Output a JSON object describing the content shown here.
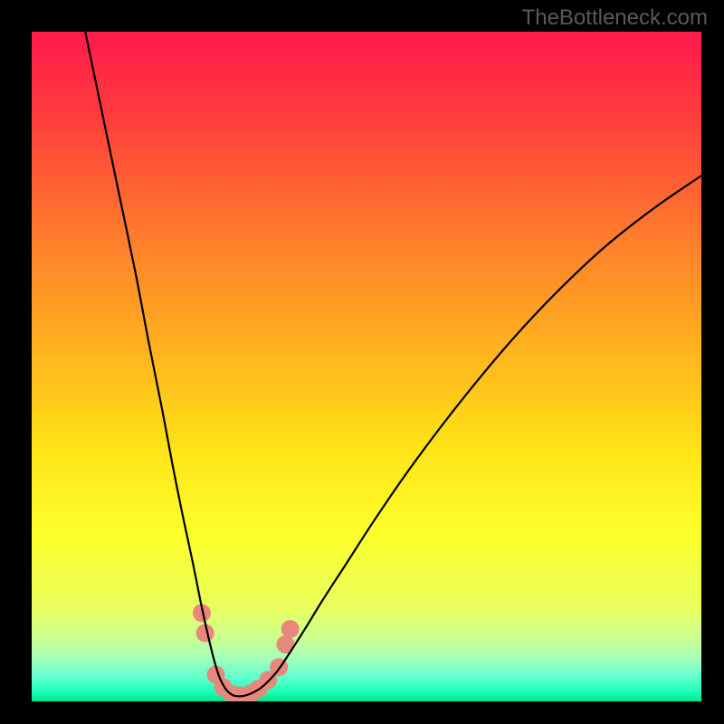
{
  "watermark": "TheBottleneck.com",
  "chart_data": {
    "type": "line",
    "title": "",
    "xlabel": "",
    "ylabel": "",
    "xlim": [
      0,
      100
    ],
    "ylim": [
      0,
      100
    ],
    "background_gradient_stops": [
      {
        "offset": 0.0,
        "color": "#ff1a4b"
      },
      {
        "offset": 0.12,
        "color": "#ff3b3e"
      },
      {
        "offset": 0.3,
        "color": "#ff7a2c"
      },
      {
        "offset": 0.48,
        "color": "#ffb41f"
      },
      {
        "offset": 0.62,
        "color": "#ffe317"
      },
      {
        "offset": 0.75,
        "color": "#fdff2b"
      },
      {
        "offset": 0.86,
        "color": "#e9ff5e"
      },
      {
        "offset": 0.905,
        "color": "#ccff8f"
      },
      {
        "offset": 0.935,
        "color": "#a6ffb9"
      },
      {
        "offset": 0.965,
        "color": "#5fffcf"
      },
      {
        "offset": 0.985,
        "color": "#1fffb7"
      },
      {
        "offset": 1.0,
        "color": "#00e68f"
      }
    ],
    "series": [
      {
        "name": "bottleneck-curve",
        "stroke": "#000000",
        "stroke_width": 2.2,
        "x": [
          8.0,
          10.5,
          13.0,
          15.5,
          17.5,
          19.5,
          21.0,
          22.5,
          24.0,
          25.2,
          26.3,
          27.2,
          28.0,
          28.8,
          29.6,
          30.5,
          32.0,
          34.2,
          36.5,
          38.5,
          40.8,
          43.5,
          47.0,
          51.0,
          55.5,
          60.5,
          66.0,
          72.0,
          78.5,
          85.5,
          93.0,
          100.0
        ],
        "y": [
          100.0,
          88.0,
          76.0,
          64.0,
          53.5,
          43.5,
          35.5,
          28.0,
          21.0,
          15.0,
          10.0,
          6.3,
          3.7,
          2.1,
          1.2,
          0.8,
          0.9,
          2.0,
          4.3,
          7.2,
          10.8,
          15.2,
          20.6,
          26.8,
          33.4,
          40.2,
          47.2,
          54.3,
          61.2,
          67.8,
          73.7,
          78.5
        ]
      }
    ],
    "markers": {
      "name": "highlight-dots",
      "color": "#e8887d",
      "radius": 10,
      "points": [
        {
          "x": 25.4,
          "y": 13.2
        },
        {
          "x": 25.9,
          "y": 10.2
        },
        {
          "x": 27.5,
          "y": 4.0
        },
        {
          "x": 28.6,
          "y": 2.1
        },
        {
          "x": 29.9,
          "y": 1.1
        },
        {
          "x": 31.3,
          "y": 0.9
        },
        {
          "x": 32.7,
          "y": 1.2
        },
        {
          "x": 33.9,
          "y": 1.9
        },
        {
          "x": 35.3,
          "y": 3.2
        },
        {
          "x": 36.9,
          "y": 5.1
        },
        {
          "x": 37.9,
          "y": 8.5
        },
        {
          "x": 38.6,
          "y": 10.8
        }
      ]
    }
  }
}
